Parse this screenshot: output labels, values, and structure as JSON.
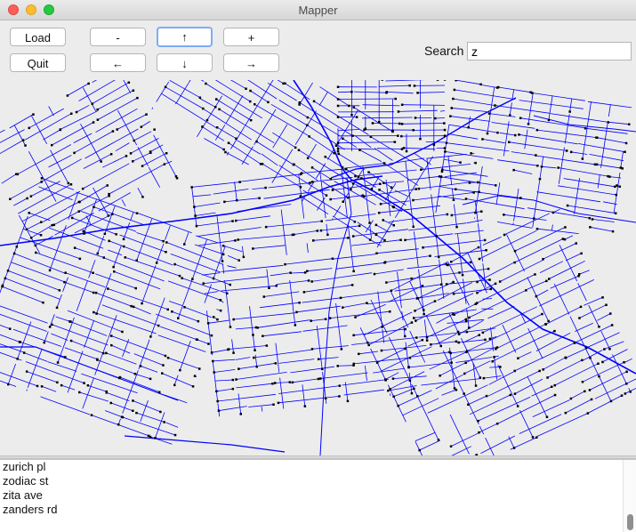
{
  "window": {
    "title": "Mapper"
  },
  "toolbar": {
    "load_label": "Load",
    "quit_label": "Quit",
    "zoom_out_label": "-",
    "zoom_in_label": "+",
    "up_label": "↑",
    "down_label": "↓",
    "left_label": "←",
    "right_label": "→"
  },
  "search": {
    "label": "Search",
    "value": "z"
  },
  "results": {
    "items": [
      "zurich pl",
      "zodiac st",
      "zita ave",
      "zanders rd"
    ]
  },
  "colors": {
    "road": "#0000ff",
    "node": "#000000",
    "map_bg": "#ececec"
  }
}
